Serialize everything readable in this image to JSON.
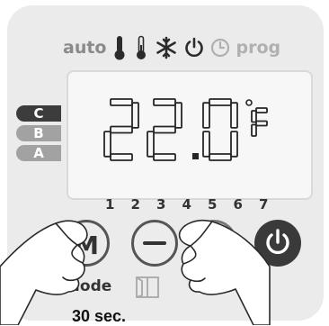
{
  "modes": {
    "auto_label": "auto",
    "prog_label": "prog",
    "icons": [
      "thermometer-comfort-icon",
      "thermometer-eco-icon",
      "snowflake-icon",
      "standby-icon",
      "clock-icon"
    ]
  },
  "display": {
    "temperature": "22.0",
    "unit": "°F"
  },
  "programs": {
    "c": "C",
    "b": "B",
    "a": "A"
  },
  "days": [
    "1",
    "2",
    "3",
    "4",
    "5",
    "6",
    "7"
  ],
  "buttons": {
    "mode": "M",
    "mode_label": "Mode"
  },
  "instruction": {
    "hold_time": "30 sec."
  },
  "colors": {
    "lcd_segment": "#262626",
    "panel": "#ebebeb",
    "dim_icon": "#b0b0b0",
    "dark": "#3a3a3a"
  }
}
